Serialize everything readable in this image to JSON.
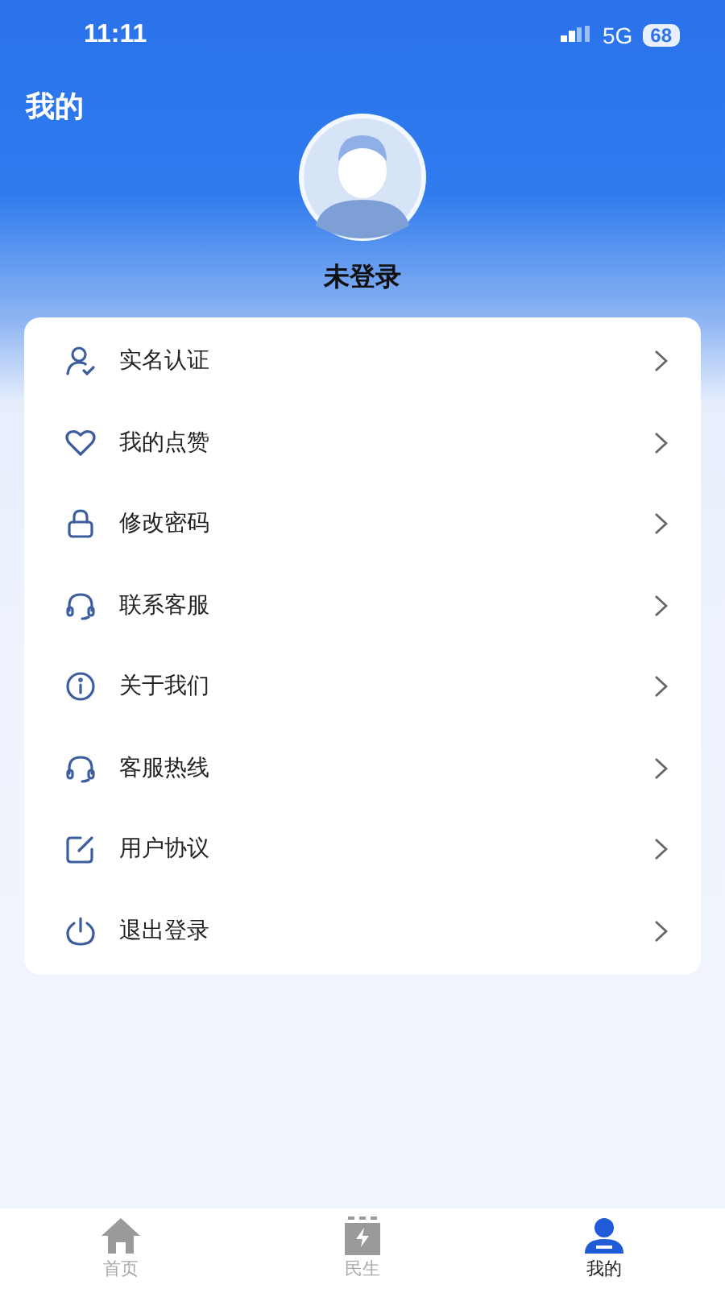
{
  "status_bar": {
    "time": "11:11",
    "network": "5G",
    "battery": "68"
  },
  "header": {
    "title": "我的"
  },
  "profile": {
    "name": "未登录"
  },
  "menu": [
    {
      "label": "实名认证",
      "kind": "person"
    },
    {
      "label": "我的点赞",
      "kind": "heart"
    },
    {
      "label": "修改密码",
      "kind": "lock"
    },
    {
      "label": "联系客服",
      "kind": "headset"
    },
    {
      "label": "关于我们",
      "kind": "info"
    },
    {
      "label": "客服热线",
      "kind": "headset"
    },
    {
      "label": "用户协议",
      "kind": "edit"
    },
    {
      "label": "退出登录",
      "kind": "power"
    }
  ],
  "tabs": [
    {
      "label": "首页",
      "kind": "home",
      "selected": false
    },
    {
      "label": "民生",
      "kind": "battery",
      "selected": false
    },
    {
      "label": "我的",
      "kind": "user",
      "selected": true
    }
  ]
}
